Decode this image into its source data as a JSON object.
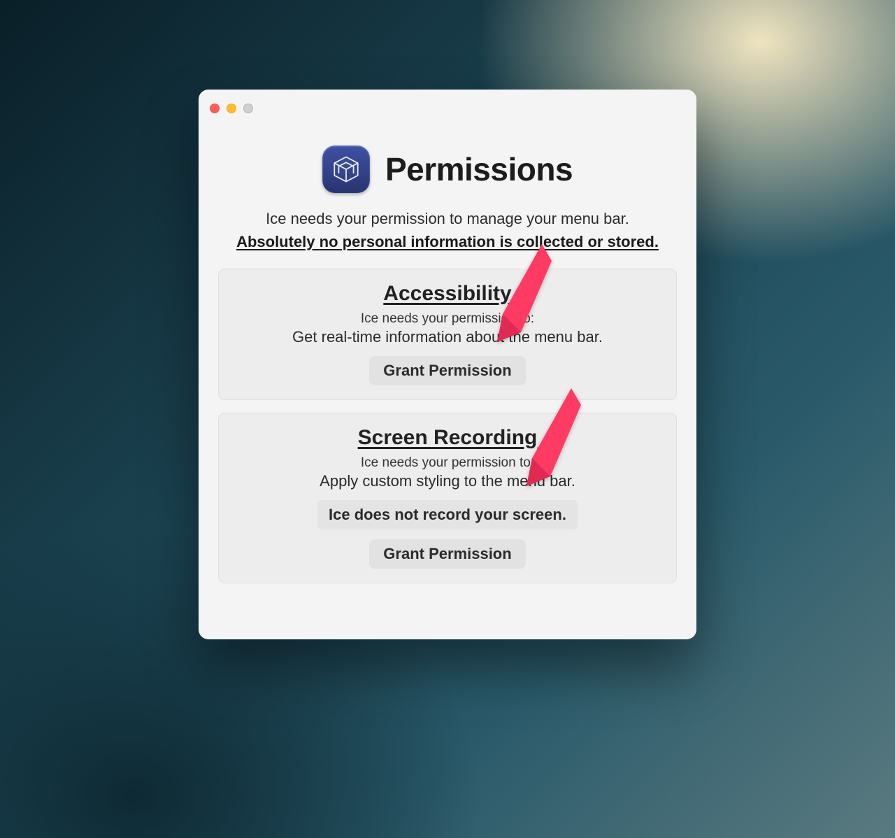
{
  "header": {
    "title": "Permissions",
    "subline": "Ice needs your permission to manage your menu bar.",
    "emphasis": "Absolutely no personal information is collected or stored."
  },
  "cards": [
    {
      "id": "accessibility",
      "title": "Accessibility",
      "line1": "Ice needs your permission to:",
      "line2": "Get real-time information about the menu bar.",
      "note": null,
      "button": "Grant Permission"
    },
    {
      "id": "screen-recording",
      "title": "Screen Recording",
      "line1": "Ice needs your permission to:",
      "line2": "Apply custom styling to the menu bar.",
      "note": "Ice does not record your screen.",
      "button": "Grant Permission"
    }
  ],
  "annotations": {
    "arrow_color": "#ff3b63"
  }
}
